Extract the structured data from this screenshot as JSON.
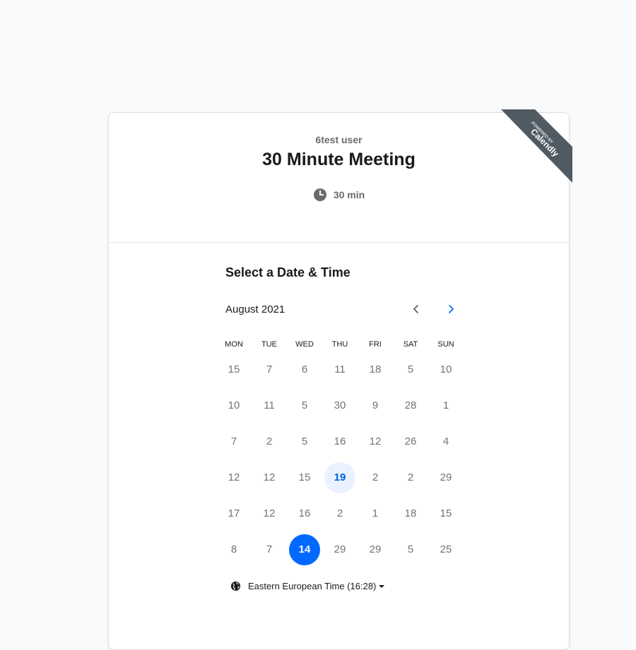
{
  "badge": {
    "line1": "POWERED BY",
    "line2": "Calendly"
  },
  "header": {
    "owner": "6test user",
    "title": "30 Minute Meeting",
    "duration": "30 min",
    "duration_icon": "clock-icon"
  },
  "calendar": {
    "section_title": "Select a Date & Time",
    "month": "August 2021",
    "prev_icon": "chevron-left-icon",
    "next_icon": "chevron-right-icon",
    "weekdays": [
      "MON",
      "TUE",
      "WED",
      "THU",
      "FRI",
      "SAT",
      "SUN"
    ],
    "weeks": [
      [
        "15",
        "7",
        "6",
        "11",
        "18",
        "5",
        "10"
      ],
      [
        "10",
        "11",
        "5",
        "30",
        "9",
        "28",
        "1"
      ],
      [
        "7",
        "2",
        "5",
        "16",
        "12",
        "26",
        "4"
      ],
      [
        "12",
        "12",
        "15",
        "19",
        "2",
        "2",
        "29"
      ],
      [
        "17",
        "12",
        "16",
        "2",
        "1",
        "18",
        "15"
      ],
      [
        "8",
        "7",
        "14",
        "29",
        "29",
        "5",
        "25"
      ]
    ],
    "available_day": "19",
    "selected_day": "14"
  },
  "timezone": {
    "label": "Eastern European Time (16:28)",
    "icon": "globe-icon"
  },
  "colors": {
    "accent": "#0069ff",
    "available_bg": "#ebf2ff",
    "badge_bg": "#505a63"
  }
}
